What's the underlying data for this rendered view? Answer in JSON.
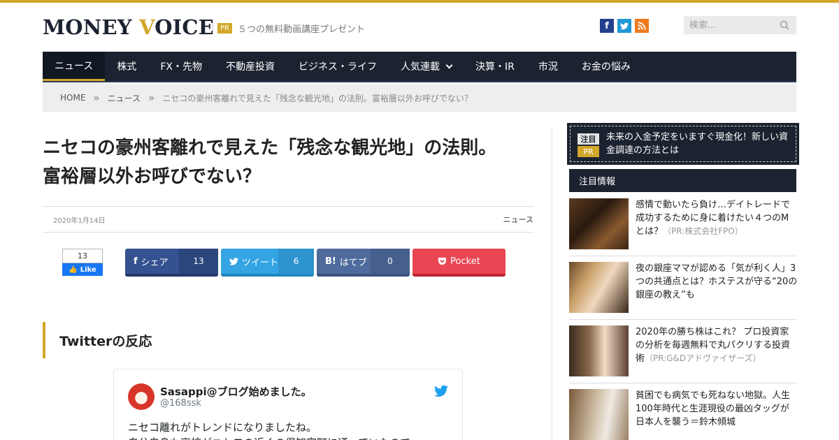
{
  "colors": {
    "accent": "#d2a72a",
    "navy": "#1c2330"
  },
  "header": {
    "logo_part1": "MONEY ",
    "logo_y": "V",
    "logo_part2": "OICE",
    "pr_badge": "PR",
    "pr_text": "５つの無料動画講座プレゼント",
    "social": [
      "facebook-icon",
      "twitter-icon",
      "rss-icon"
    ],
    "search_placeholder": "検索..."
  },
  "nav": {
    "items": [
      {
        "label": "ニュース",
        "active": true
      },
      {
        "label": "株式"
      },
      {
        "label": "FX・先物"
      },
      {
        "label": "不動産投資"
      },
      {
        "label": "ビジネス・ライフ"
      },
      {
        "label": "人気連載",
        "dropdown": true
      },
      {
        "label": "決算・IR"
      },
      {
        "label": "市況"
      },
      {
        "label": "お金の悩み"
      }
    ]
  },
  "breadcrumb": {
    "home": "HOME",
    "sep": "»",
    "category": "ニュース",
    "current": "ニセコの豪州客離れで見えた「残念な観光地」の法則。富裕層以外お呼びでない？"
  },
  "article": {
    "title": "ニセコの豪州客離れで見えた「残念な観光地」の法則。富裕層以外お呼びでない？",
    "date": "2020年1月14日",
    "category": "ニュース"
  },
  "share": {
    "fb_like_count": "13",
    "fb_like_label": "Like",
    "facebook": {
      "icon": "f",
      "label": "シェア",
      "count": "13"
    },
    "twitter": {
      "label": "ツイート",
      "count": "6"
    },
    "hatena": {
      "icon": "B!",
      "label": "はてブ",
      "count": "0"
    },
    "pocket": {
      "label": "Pocket"
    }
  },
  "section": {
    "heading": "Twitterの反応"
  },
  "tweet": {
    "name": "Sasappi@ブログ始めました。",
    "handle": "@168ssk",
    "text": "ニセコ離れがトレンドになりましたね。\n自分自身も高校がニセコの近くの倶知安町に通っていたので"
  },
  "sidebar": {
    "pr_box": {
      "badge1": "注目",
      "badge2": "PR",
      "text": "未来の入金予定をいますぐ現金化！新しい資金調達の方法とは"
    },
    "heading": "注目情報",
    "items": [
      {
        "text": "感情で動いたら負け…デイトレードで成功するために身に着けたい４つのMとは？",
        "pr": "（PR:株式会社FPO）"
      },
      {
        "text": "夜の銀座ママが認める「気が利く人」3つの共通点とは？ホステスが守る“20の銀座の教え”も",
        "pr": ""
      },
      {
        "text": "2020年の勝ち株はこれ？ プロ投資家の分析を毎週無料で丸パクリする投資術",
        "pr": "（PR:G&Dアドヴァイザーズ）"
      },
      {
        "text": "貧困でも病気でも死ねない地獄。人生100年時代と生涯現役の最凶タッグが日本人を襲う＝鈴木傾城",
        "pr": ""
      }
    ]
  }
}
